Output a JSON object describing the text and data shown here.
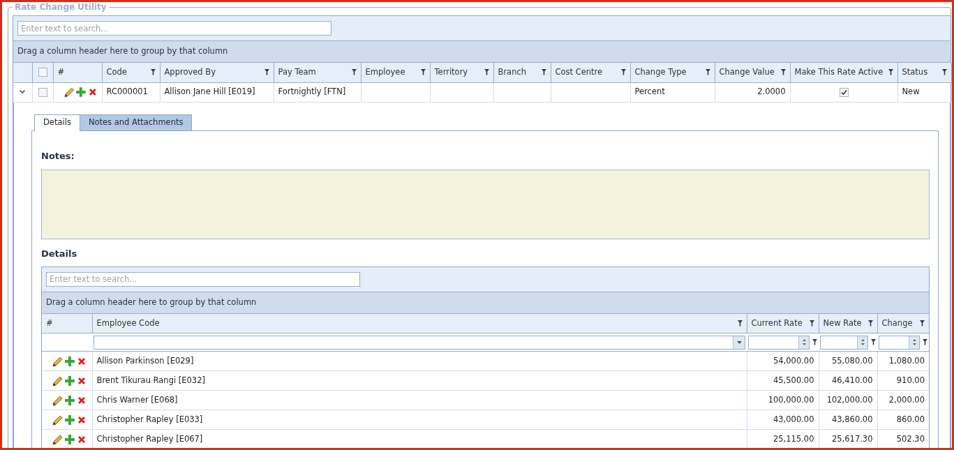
{
  "panel": {
    "title": "Rate Change Utility"
  },
  "grid": {
    "search": {
      "placeholder": "Enter text to search..."
    },
    "group_hint": "Drag a column header here to group by that column",
    "select_all": {
      "checked": false
    },
    "columns": [
      {
        "label": "#",
        "filter": false,
        "kind": "actions"
      },
      {
        "label": "Code",
        "filter": true,
        "kind": "text"
      },
      {
        "label": "Approved By",
        "filter": true,
        "kind": "text"
      },
      {
        "label": "Pay Team",
        "filter": true,
        "kind": "text"
      },
      {
        "label": "Employee",
        "filter": true,
        "kind": "text"
      },
      {
        "label": "Territory",
        "filter": true,
        "kind": "text"
      },
      {
        "label": "Branch",
        "filter": true,
        "kind": "text"
      },
      {
        "label": "Cost Centre",
        "filter": true,
        "kind": "text"
      },
      {
        "label": "Change Type",
        "filter": true,
        "kind": "text"
      },
      {
        "label": "Change Value",
        "filter": true,
        "kind": "number"
      },
      {
        "label": "Make This Rate Active",
        "filter": true,
        "kind": "checkbox"
      },
      {
        "label": "Status",
        "filter": true,
        "kind": "text"
      }
    ],
    "rows": [
      {
        "expanded": true,
        "checked": false,
        "cells": [
          null,
          "RC000001",
          "Allison Jane Hill [E019]",
          "Fortnightly [FTN]",
          null,
          null,
          null,
          null,
          "Percent",
          "2.0000",
          true,
          "New"
        ]
      }
    ]
  },
  "detail": {
    "tabs": [
      {
        "label": "Details",
        "selected": true
      },
      {
        "label": "Notes and Attachments",
        "selected": false
      }
    ],
    "notes_label": "Notes:",
    "details_heading": "Details",
    "grid": {
      "search": {
        "placeholder": "Enter text to search..."
      },
      "group_hint": "Drag a column header here to group by that column",
      "columns": [
        {
          "label": "#",
          "filter": false,
          "kind": "actions"
        },
        {
          "label": "Employee Code",
          "filter": true,
          "kind": "text"
        },
        {
          "label": "Current Rate",
          "filter": true,
          "kind": "number"
        },
        {
          "label": "New Rate",
          "filter": true,
          "kind": "number"
        },
        {
          "label": "Change",
          "filter": true,
          "kind": "number"
        }
      ],
      "rows": [
        {
          "cells": [
            null,
            "Allison Parkinson [E029]",
            "54,000.00",
            "55,080.00",
            "1,080.00"
          ]
        },
        {
          "cells": [
            null,
            "Brent Tikurau Rangi [E032]",
            "45,500.00",
            "46,410.00",
            "910.00"
          ]
        },
        {
          "cells": [
            null,
            "Chris Warner [E068]",
            "100,000.00",
            "102,000.00",
            "2,000.00"
          ]
        },
        {
          "cells": [
            null,
            "Christopher Rapley [E033]",
            "43,000.00",
            "43,860.00",
            "860.00"
          ]
        },
        {
          "cells": [
            null,
            "Christopher Rapley [E067]",
            "25,115.00",
            "25,617.30",
            "502.30"
          ]
        }
      ]
    }
  }
}
